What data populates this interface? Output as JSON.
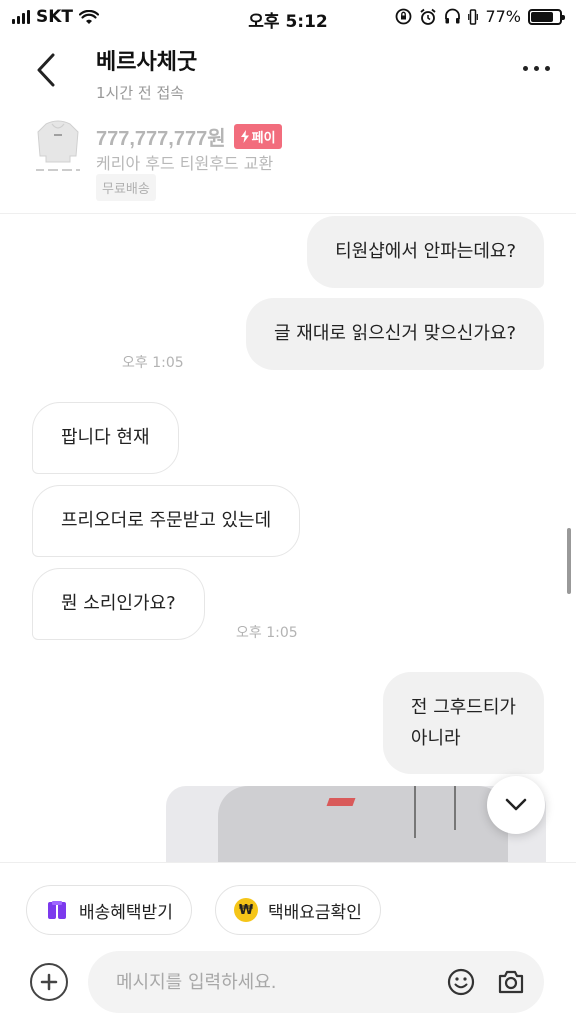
{
  "status_bar": {
    "carrier": "SKT",
    "time": "오후 5:12",
    "battery": "77%",
    "battery_level": 0.77
  },
  "header": {
    "title": "베르사체굿",
    "subtitle": "1시간 전 접속"
  },
  "product": {
    "price": "777,777,777원",
    "pay_badge": "페이",
    "name": "케리아 후드 티원후드 교환",
    "shipping": "무료배송"
  },
  "messages": [
    {
      "side": "sent",
      "text": "티원샵에서 안파는데요?"
    },
    {
      "side": "sent",
      "text": "글 재대로 읽으신거 맞으신가요?"
    },
    {
      "side": "recv",
      "text": "팝니다 현재"
    },
    {
      "side": "recv",
      "text": "프리오더로 주문받고 있는데"
    },
    {
      "side": "recv",
      "text": "뭔 소리인가요?"
    },
    {
      "side": "sent",
      "text_line1": "전 그후드티가",
      "text_line2": "아니라"
    }
  ],
  "timestamps": {
    "sent_group1": "오후 1:05",
    "recv_group1": "오후 1:05"
  },
  "quick_actions": {
    "shipping_benefit": "배송혜택받기",
    "fee_check": "택배요금확인",
    "won_symbol": "₩"
  },
  "composer": {
    "placeholder": "메시지를 입력하세요.",
    "value": ""
  },
  "colors": {
    "pay_badge": "#f26d7d",
    "purple_icon": "#7c3aed",
    "won_icon": "#f5c518"
  },
  "icons": {
    "back": "chevron-left-icon",
    "more": "more-horizontal-icon",
    "scroll_down": "chevron-down-icon",
    "add": "plus-circle-icon",
    "emoji": "smile-icon",
    "camera": "camera-icon"
  }
}
